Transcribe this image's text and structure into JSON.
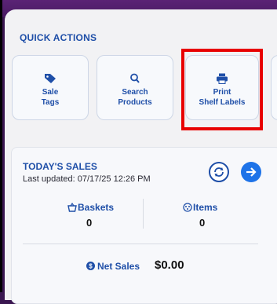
{
  "quick_actions": {
    "title": "QUICK ACTIONS",
    "items": [
      {
        "icon": "tag-icon",
        "label": "Sale\nTags"
      },
      {
        "icon": "search-icon",
        "label": "Search\nProducts"
      },
      {
        "icon": "printer-icon",
        "label": "Print\nShelf Labels"
      }
    ]
  },
  "todays_sales": {
    "title": "TODAY'S SALES",
    "last_updated": "Last updated: 07/17/25 12:26 PM",
    "baskets": {
      "label": "Baskets",
      "value": "0"
    },
    "items": {
      "label": "Items",
      "value": "0"
    },
    "net_sales": {
      "label": "Net Sales",
      "value": "$0.00"
    }
  },
  "colors": {
    "accent": "#1f4fa8",
    "highlight": "#e80000",
    "header_purple": "#4a1b63",
    "go_button": "#1e73e8"
  }
}
